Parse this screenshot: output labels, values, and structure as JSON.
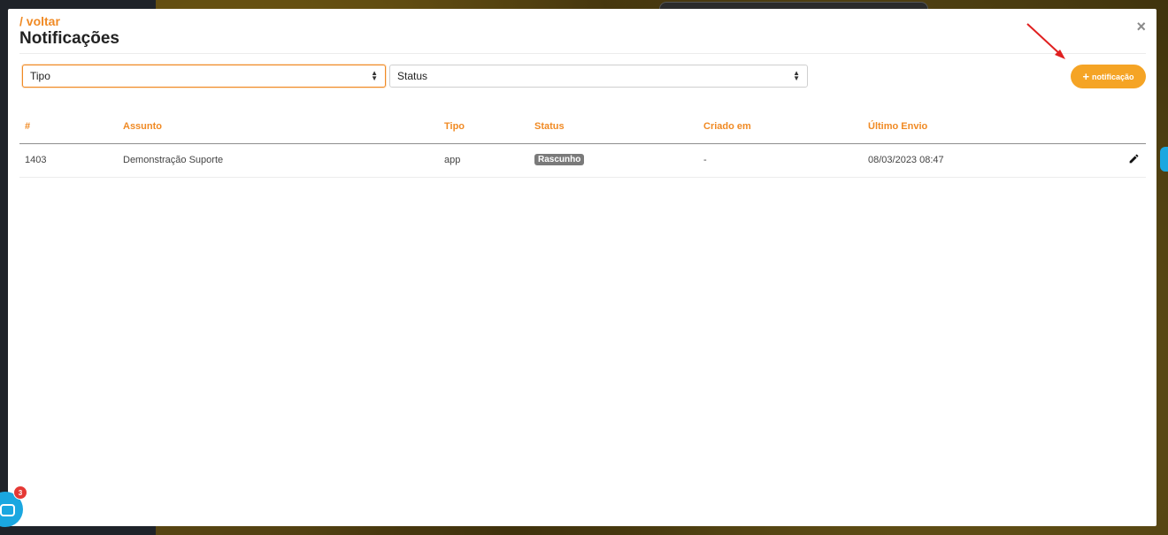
{
  "header": {
    "back_label": "/ voltar",
    "title": "Notificações",
    "close_label": "×"
  },
  "filters": {
    "type_value": "Tipo",
    "status_value": "Status"
  },
  "actions": {
    "add_label": "notificação",
    "add_icon": "+"
  },
  "table": {
    "columns": [
      "#",
      "Assunto",
      "Tipo",
      "Status",
      "Criado em",
      "Último Envio"
    ],
    "rows": [
      {
        "id": "1403",
        "subject": "Demonstração Suporte",
        "type": "app",
        "status": "Rascunho",
        "created": "-",
        "last_sent": "08/03/2023 08:47"
      }
    ]
  },
  "chat": {
    "unread": "3"
  },
  "colors": {
    "accent": "#f08a24",
    "button": "#f5a425",
    "badge": "#7a7a7a",
    "chat": "#1aa7e0"
  }
}
